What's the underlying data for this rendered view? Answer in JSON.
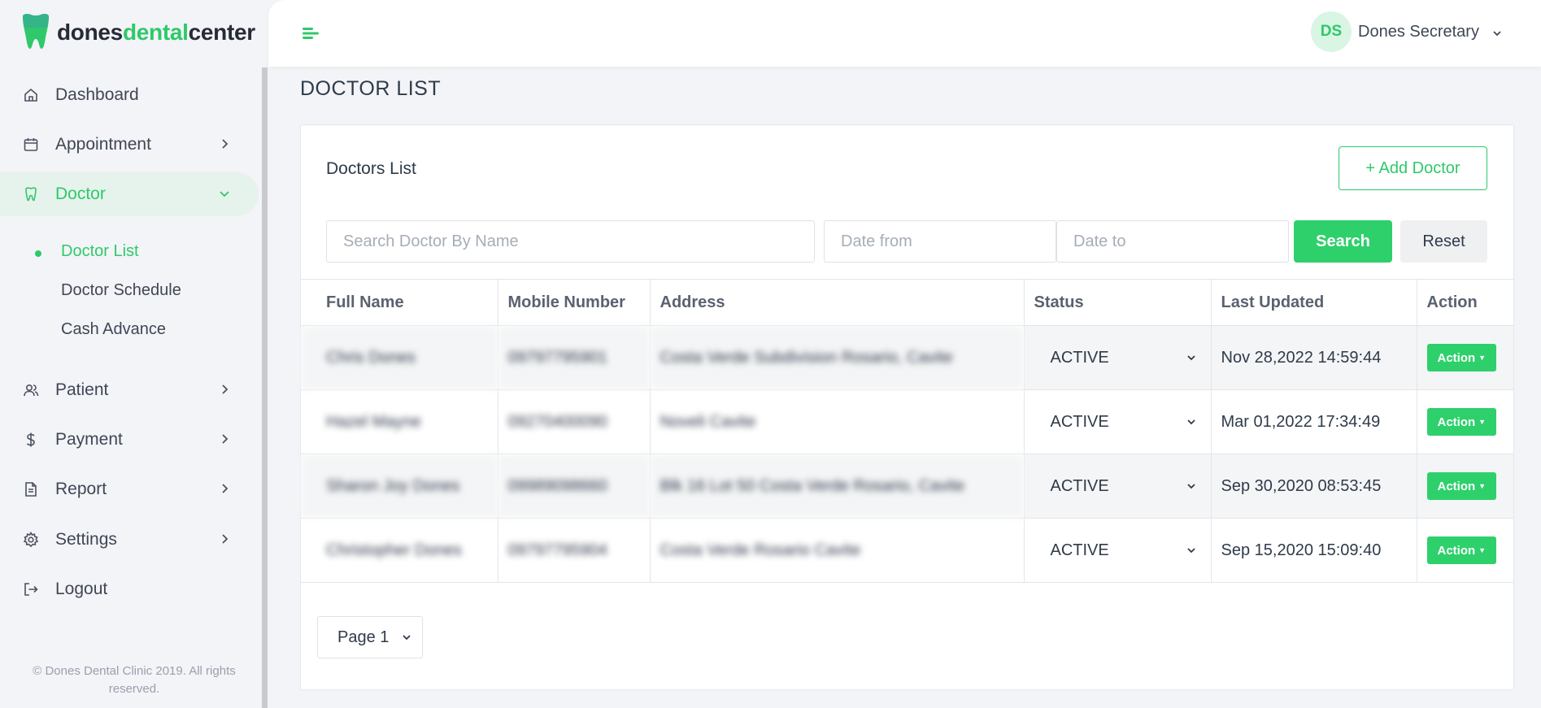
{
  "brand": {
    "part1": "dones",
    "part2": "dental",
    "part3": "center",
    "accent_color": "#2ec96a"
  },
  "sidebar": {
    "items": [
      {
        "label": "Dashboard",
        "icon": "home-icon"
      },
      {
        "label": "Appointment",
        "icon": "calendar-icon"
      },
      {
        "label": "Doctor",
        "icon": "tooth-icon"
      },
      {
        "label": "Patient",
        "icon": "users-icon"
      },
      {
        "label": "Payment",
        "icon": "dollar-icon"
      },
      {
        "label": "Report",
        "icon": "document-icon"
      },
      {
        "label": "Settings",
        "icon": "gear-icon"
      },
      {
        "label": "Logout",
        "icon": "logout-icon"
      }
    ],
    "doctor_subitems": [
      "Doctor List",
      "Doctor Schedule",
      "Cash Advance"
    ],
    "footer": "© Dones Dental Clinic 2019. All rights reserved."
  },
  "header": {
    "avatar_initials": "DS",
    "user_name": "Dones Secretary"
  },
  "main": {
    "page_title": "DOCTOR LIST",
    "card_title": "Doctors List",
    "add_button": "+ Add Doctor",
    "search_placeholder": "Search Doctor By Name",
    "date_from_placeholder": "Date from",
    "date_to_placeholder": "Date to",
    "search_button": "Search",
    "reset_button": "Reset",
    "columns": [
      "Full Name",
      "Mobile Number",
      "Address",
      "Status",
      "Last Updated",
      "Action"
    ],
    "rows": [
      {
        "name": "Chris Dones",
        "mobile": "09797795901",
        "address": "Costa Verde Subdivision Rosario, Cavite",
        "status": "ACTIVE",
        "updated": "Nov 28,2022 14:59:44",
        "action": "Action"
      },
      {
        "name": "Hazel Mayne",
        "mobile": "09270400090",
        "address": "Noveli Cavite",
        "status": "ACTIVE",
        "updated": "Mar 01,2022 17:34:49",
        "action": "Action"
      },
      {
        "name": "Sharon Joy Dones",
        "mobile": "09989098660",
        "address": "Blk 16 Lot 50 Costa Verde Rosario, Cavite",
        "status": "ACTIVE",
        "updated": "Sep 30,2020 08:53:45",
        "action": "Action"
      },
      {
        "name": "Christopher Dones",
        "mobile": "09797795904",
        "address": "Costa Verde Rosario Cavite",
        "status": "ACTIVE",
        "updated": "Sep 15,2020 15:09:40",
        "action": "Action"
      }
    ],
    "page_select": "Page 1"
  }
}
